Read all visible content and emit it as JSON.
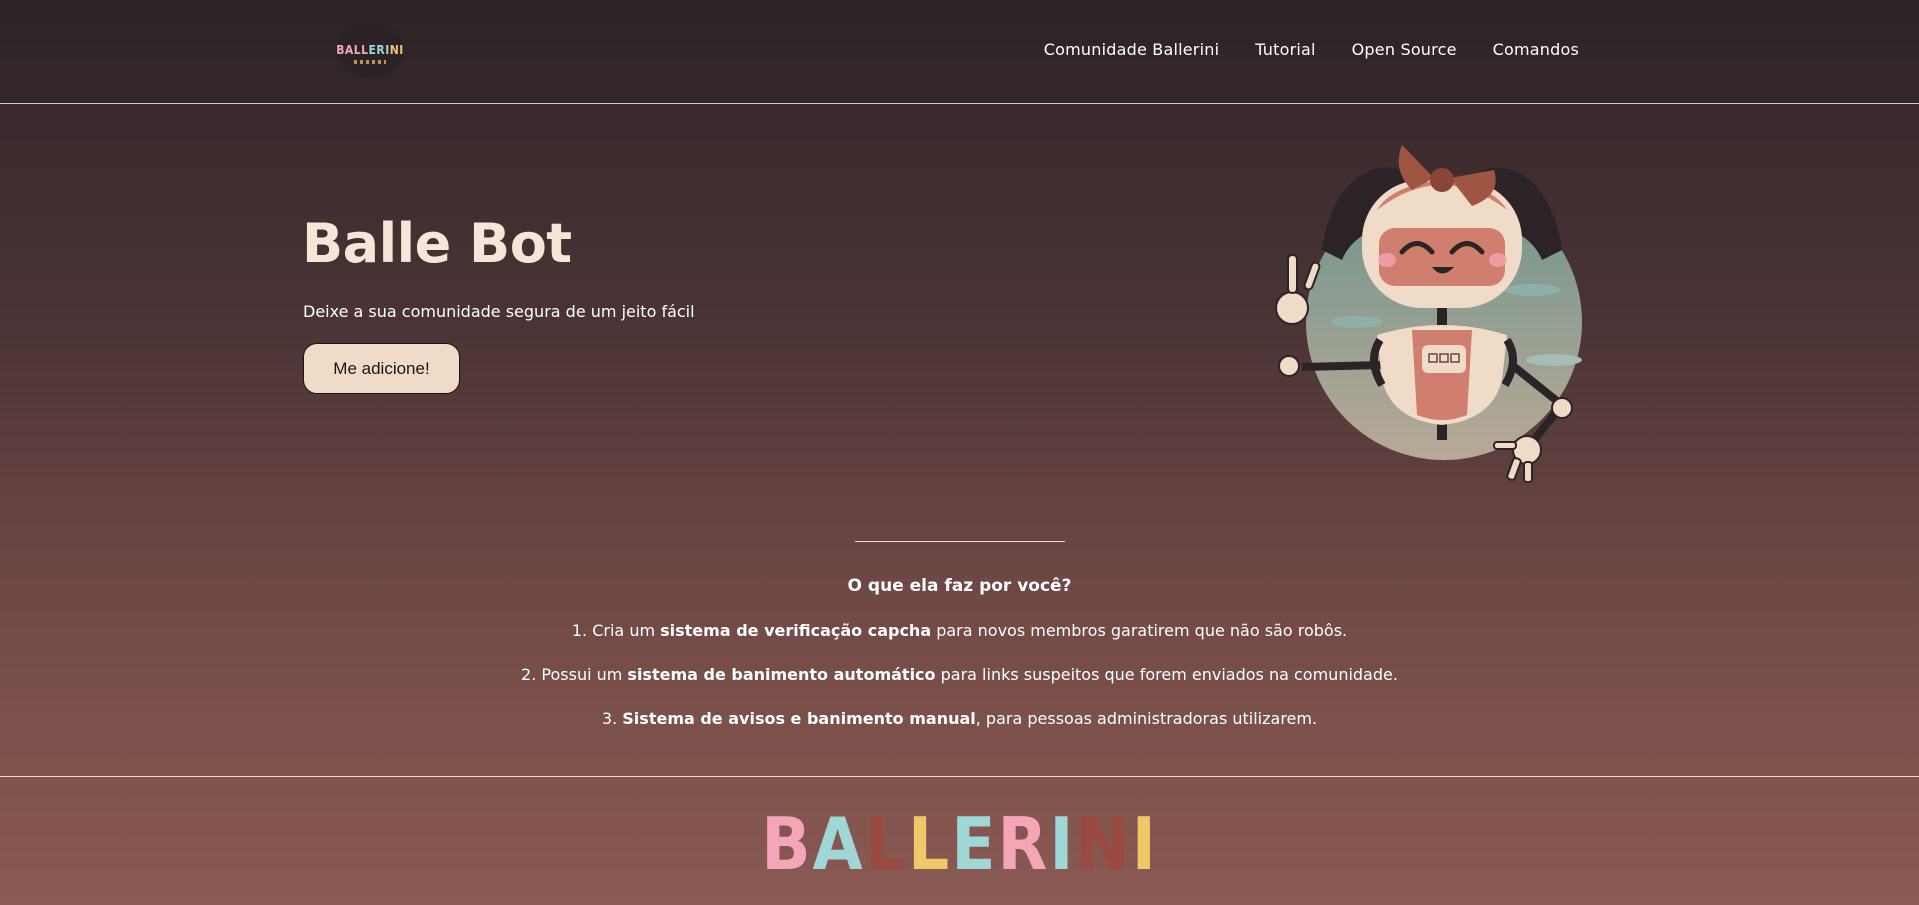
{
  "header": {
    "logo_text": [
      "BALL",
      "ERI",
      "NI"
    ],
    "nav": [
      {
        "label": "Comunidade Ballerini"
      },
      {
        "label": "Tutorial"
      },
      {
        "label": "Open Source"
      },
      {
        "label": "Comandos"
      }
    ]
  },
  "hero": {
    "title": "Balle Bot",
    "subtitle": "Deixe a sua comunidade segura de um jeito fácil",
    "button_label": "Me adicione!"
  },
  "features": {
    "title": "O que ela faz por você?",
    "items": [
      {
        "prefix": "1. Cria um ",
        "bold": "sistema de verificação capcha",
        "suffix": " para novos membros garatirem que não são robôs."
      },
      {
        "prefix": "2. Possui um ",
        "bold": "sistema de banimento automático",
        "suffix": " para links suspeitos que forem enviados na comunidade."
      },
      {
        "prefix": "3. ",
        "bold": "Sistema de avisos e banimento manual",
        "suffix": ", para pessoas administradoras utilizarem."
      }
    ]
  },
  "footer": {
    "brand_letters": [
      {
        "ch": "B",
        "color": "#f4a6b8"
      },
      {
        "ch": "A",
        "color": "#9fd6d6"
      },
      {
        "ch": "L",
        "color": "#9a4a3e"
      },
      {
        "ch": "L",
        "color": "#f0c86a"
      },
      {
        "ch": "E",
        "color": "#9fd6d6"
      },
      {
        "ch": "R",
        "color": "#f4a6b8"
      },
      {
        "ch": "I",
        "color": "#9fd6d6"
      },
      {
        "ch": "N",
        "color": "#9a4a3e"
      },
      {
        "ch": "I",
        "color": "#f0c86a"
      }
    ]
  },
  "colors": {
    "accent": "#f0dac8",
    "title": "#f7e6d8"
  },
  "icons": {
    "robot": "robot-mascot-illustration"
  }
}
